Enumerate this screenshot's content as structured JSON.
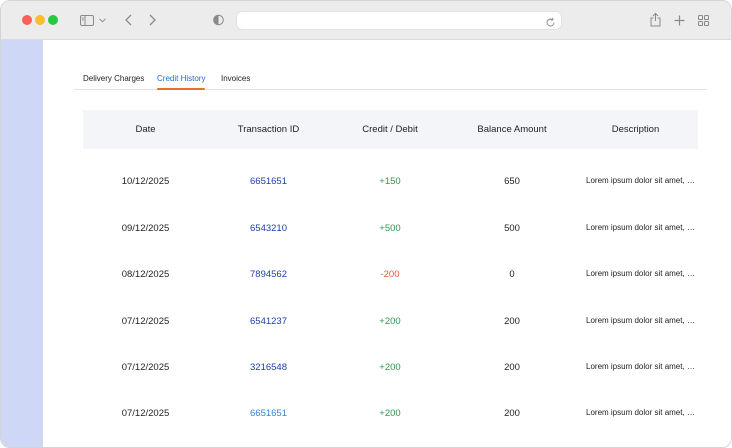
{
  "browser": {
    "address_value": "",
    "icons": [
      "sidebar-icon",
      "chevron-down-icon",
      "back-icon",
      "forward-icon",
      "shield-icon",
      "reload-icon",
      "share-icon",
      "plus-icon",
      "tabs-overview-icon"
    ]
  },
  "tabs": [
    {
      "label": "Delivery Charges",
      "active": false
    },
    {
      "label": "Credit History",
      "active": true
    },
    {
      "label": "Invoices",
      "active": false
    }
  ],
  "colors": {
    "accent_tab": "#1c70cc",
    "tab_underline": "#e8702a",
    "left_rail": "#ced7f5",
    "credit": "#2e9a49",
    "debit": "#e05a4a",
    "txn_link": "#1b3fa8"
  },
  "table": {
    "columns": [
      "Date",
      "Transaction ID",
      "Credit / Debit",
      "Balance Amount",
      "Description"
    ],
    "rows": [
      {
        "date": "10/12/2025",
        "txn": "6651651",
        "amount": "+150",
        "balance": "650",
        "desc": "Lorem ipsum dolor sit amet, consectetur"
      },
      {
        "date": "09/12/2025",
        "txn": "6543210",
        "amount": "+500",
        "balance": "500",
        "desc": "Lorem ipsum dolor sit amet, consectetur"
      },
      {
        "date": "08/12/2025",
        "txn": "7894562",
        "amount": "-200",
        "balance": "0",
        "desc": "Lorem ipsum dolor sit amet, consectetur"
      },
      {
        "date": "07/12/2025",
        "txn": "6541237",
        "amount": "+200",
        "balance": "200",
        "desc": "Lorem ipsum dolor sit amet, consectetur"
      },
      {
        "date": "07/12/2025",
        "txn": "3216548",
        "amount": "+200",
        "balance": "200",
        "desc": "Lorem ipsum dolor sit amet, consectetur"
      },
      {
        "date": "07/12/2025",
        "txn": "6651651",
        "amount": "+200",
        "balance": "200",
        "desc": "Lorem ipsum dolor sit amet, consectetur"
      }
    ]
  }
}
